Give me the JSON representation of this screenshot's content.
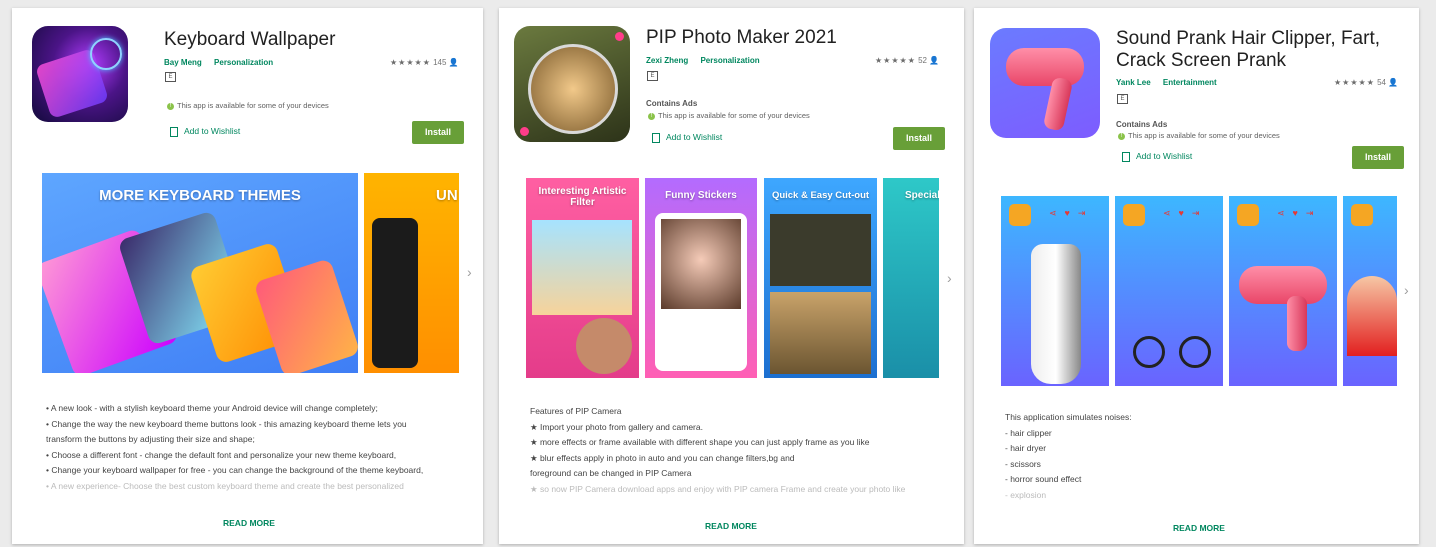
{
  "apps": [
    {
      "title_lines": [
        "Keyboard Wallpaper"
      ],
      "developer": "Bay Meng",
      "category": "Personalization",
      "stars": "★★★★★",
      "rating_count": "145",
      "contains_ads": "",
      "availability": "This app is available for some of your devices",
      "wishlist_label": "Add to Wishlist",
      "install_label": "Install",
      "screenshots": [
        {
          "caption": "MORE KEYBOARD THEMES"
        },
        {
          "caption": "UN"
        }
      ],
      "description": [
        "• A new look - with a stylish keyboard theme your Android device will change completely;",
        "• Change the way the new keyboard theme buttons look - this amazing keyboard theme lets you",
        "transform the buttons by adjusting their size and shape;",
        "• Choose a different font - change the default font and personalize your new theme keyboard,",
        "• Change your keyboard wallpaper for free - you can change the background of the theme keyboard,",
        "• A new experience- Choose the best custom keyboard theme and create the best personalized"
      ],
      "read_more": "READ MORE"
    },
    {
      "title_lines": [
        "PIP Photo Maker 2021"
      ],
      "developer": "Zexi Zheng",
      "category": "Personalization",
      "stars": "★★★★★",
      "rating_count": "52",
      "contains_ads": "Contains Ads",
      "availability": "This app is available for some of your devices",
      "wishlist_label": "Add to Wishlist",
      "install_label": "Install",
      "screenshots": [
        {
          "caption": "Interesting Artistic Filter"
        },
        {
          "caption": "Funny Stickers"
        },
        {
          "caption": "Quick & Easy Cut-out"
        },
        {
          "caption": "Special"
        }
      ],
      "description": [
        "Features of PIP Camera",
        "★ Import your photo from gallery and camera.",
        "★ more effects or frame available with different shape you can just apply frame as you like",
        "★ blur effects apply in photo in auto and you can change filters,bg and",
        "foreground can be changed in PIP Camera",
        "★ so now PIP Camera download apps and enjoy with PIP camera Frame and create your photo like"
      ],
      "read_more": "READ MORE"
    },
    {
      "title_lines": [
        "Sound Prank Hair Clipper, Fart,",
        "Crack Screen Prank"
      ],
      "developer": "Yank Lee",
      "category": "Entertainment",
      "stars": "★★★★★",
      "rating_count": "54",
      "contains_ads": "Contains Ads",
      "availability": "This app is available for some of your devices",
      "wishlist_label": "Add to Wishlist",
      "install_label": "Install",
      "screenshots": [
        {
          "caption": ""
        },
        {
          "caption": ""
        },
        {
          "caption": ""
        },
        {
          "caption": ""
        }
      ],
      "description": [
        "This application simulates noises:",
        "- hair clipper",
        "- hair dryer",
        "- scissors",
        "- horror sound effect",
        "- explosion"
      ],
      "read_more": "READ MORE"
    }
  ],
  "colors": {
    "accent_green": "#01875f",
    "install_green": "#689f38"
  }
}
